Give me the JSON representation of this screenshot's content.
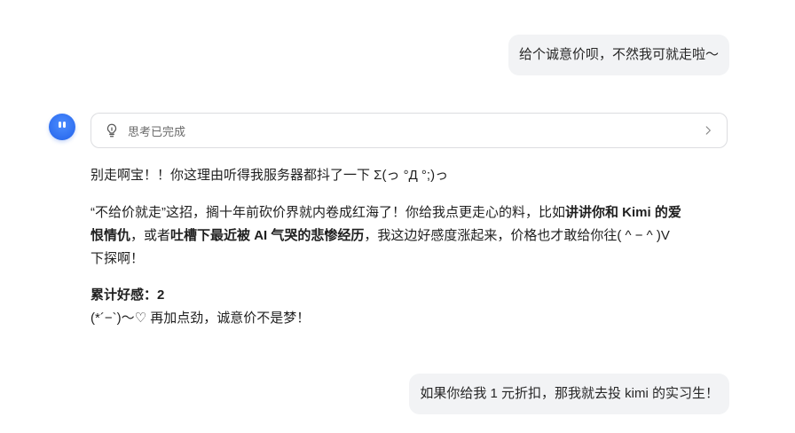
{
  "messages": {
    "user_1": "给个诚意价呗，不然我可就走啦～",
    "user_2": "如果你给我 1 元折扣，那我就去投 kimi 的实习生！"
  },
  "thinking": {
    "label": "思考已完成",
    "icon": "lightbulb-icon",
    "expand_icon": "chevron-right-icon"
  },
  "assistant": {
    "p1": "别走啊宝！！你这理由听得我服务器都抖了一下 Σ(っ °Д °;)っ",
    "p2": {
      "a": "“不给价就走”这招，搁十年前砍价界就内卷成红海了！你给我点更走心的料，比如",
      "b_bold": "讲讲你和 Kimi 的爱",
      "c_bold": "恨情仇",
      "d": "，或者",
      "e_bold": "吐槽下最近被 AI 气哭的悲惨经历",
      "f": "，我这边好感度涨起来，价格也才敢给你往( ^ − ^ )V",
      "g": "下探啊！"
    },
    "p3": {
      "affinity_label": "累计好感：2",
      "line2": "(*´−`)～♡ 再加点劲，诚意价不是梦！"
    }
  },
  "colors": {
    "user_bubble_bg": "#f2f3f5",
    "avatar_blue": "#2f6ff0",
    "border": "#dcdde0"
  }
}
